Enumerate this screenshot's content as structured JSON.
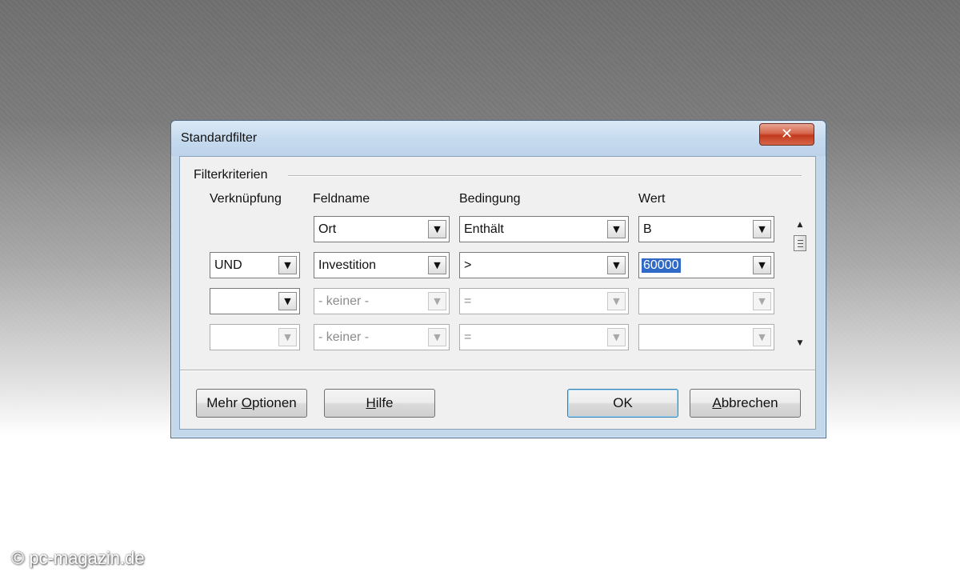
{
  "dialog": {
    "title": "Standardfilter",
    "close_glyph": "✕",
    "group_label": "Filterkriterien",
    "columns": {
      "connector": "Verknüpfung",
      "field": "Feldname",
      "condition": "Bedingung",
      "value": "Wert"
    },
    "rows": [
      {
        "connector": "",
        "field": "Ort",
        "condition": "Enthält",
        "value": "B",
        "enabled": true
      },
      {
        "connector": "UND",
        "field": "Investition",
        "condition": ">",
        "value": "60000",
        "enabled": true,
        "value_selected": true
      },
      {
        "connector": "",
        "field": "- keiner -",
        "condition": "=",
        "value": "",
        "enabled": false
      },
      {
        "connector": "",
        "field": "- keiner -",
        "condition": "=",
        "value": "",
        "enabled": false
      }
    ],
    "buttons": {
      "more_options": {
        "pre": "Mehr ",
        "mnemonic": "O",
        "post": "ptionen"
      },
      "help": {
        "mnemonic": "H",
        "post": "ilfe"
      },
      "ok": "OK",
      "cancel": {
        "mnemonic": "A",
        "post": "bbrechen"
      }
    }
  },
  "watermark": "© pc-magazin.de",
  "colors": {
    "selection": "#3169c6",
    "close_button": "#c2391c",
    "window_frame": "#c4d8ec"
  },
  "icons": [
    "close-icon",
    "dropdown-arrow-icon",
    "scroll-up-icon",
    "scroll-down-icon"
  ]
}
